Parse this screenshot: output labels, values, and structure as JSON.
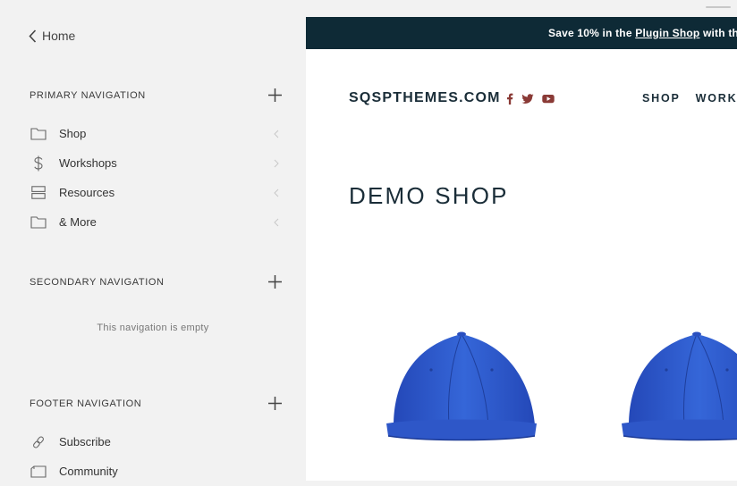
{
  "sidebar": {
    "home_label": "Home",
    "primary": {
      "title": "PRIMARY NAVIGATION",
      "items": [
        {
          "label": "Shop",
          "icon": "folder-icon"
        },
        {
          "label": "Workshops",
          "icon": "dollar-icon"
        },
        {
          "label": "Resources",
          "icon": "index-icon"
        },
        {
          "label": "& More",
          "icon": "folder-icon"
        }
      ]
    },
    "secondary": {
      "title": "SECONDARY NAVIGATION",
      "empty_text": "This navigation is empty"
    },
    "footer": {
      "title": "FOOTER NAVIGATION",
      "items": [
        {
          "label": "Subscribe",
          "icon": "link-icon"
        },
        {
          "label": "Community",
          "icon": "page-icon"
        }
      ]
    }
  },
  "preview": {
    "announcement": {
      "prefix": "Save 10% in the ",
      "link": "Plugin Shop",
      "suffix": " with the"
    },
    "site_title": "SQSPTHEMES.COM",
    "social_icons": [
      "facebook-icon",
      "twitter-icon",
      "youtube-icon"
    ],
    "nav": [
      "SHOP",
      "WORKS"
    ],
    "heading": "DEMO SHOP",
    "products": [
      "blue-cap-image",
      "blue-cap-image"
    ]
  },
  "colors": {
    "sidebar_bg": "#f2f2f2",
    "announcement_bg": "#0e2a36",
    "text_dark": "#1a2d38",
    "social_red": "#8a3a36",
    "cap_blue": "#2f5fd0"
  }
}
